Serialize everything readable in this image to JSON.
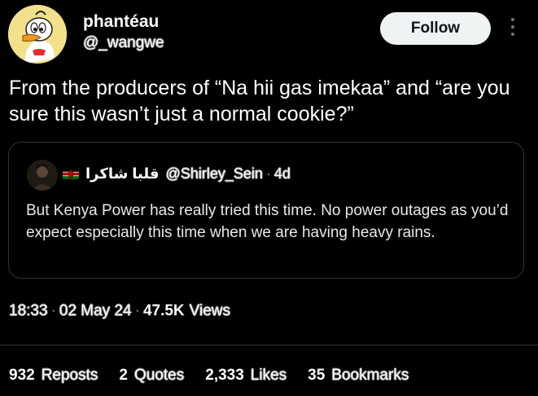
{
  "author": {
    "display_name": "phantéau",
    "handle": "@_wangwe",
    "avatar_icon": "duck-cartoon-avatar-icon"
  },
  "header": {
    "follow_label": "Follow",
    "more_icon": "more-vertical-icon"
  },
  "tweet": {
    "text": "From the producers of “Na hii gas imekaa” and “are you sure this wasn’t just a normal cookie?”"
  },
  "quote": {
    "avatar_icon": "user-avatar-icon",
    "flag_icon": "kenya-flag-icon",
    "display_name": "قلبا شاكرا",
    "handle": "@Shirley_Sein",
    "separator": "·",
    "age": "4d",
    "text": "But Kenya Power has really tried this time. No power outages as you’d expect especially this time when we are having heavy rains."
  },
  "meta": {
    "time": "18:33",
    "date": "02 May 24",
    "views_count": "47.5K",
    "views_label": "Views",
    "separator": "·"
  },
  "stats": {
    "reposts_count": "932",
    "reposts_label": "Reposts",
    "quotes_count": "2",
    "quotes_label": "Quotes",
    "likes_count": "2,333",
    "likes_label": "Likes",
    "bookmarks_count": "35",
    "bookmarks_label": "Bookmarks"
  },
  "colors": {
    "background": "#000000",
    "text": "#e7e9ea",
    "muted": "#8b98a5",
    "border": "#2f3336",
    "button_bg": "#eff3f4"
  }
}
